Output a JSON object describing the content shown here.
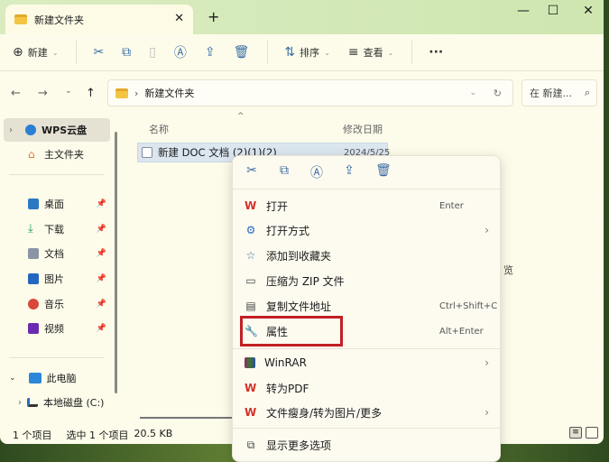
{
  "window": {
    "tab_title": "新建文件夹",
    "tab_close": "✕",
    "new_tab": "+",
    "minimize": "—",
    "maximize": "☐",
    "close": "✕"
  },
  "toolbar": {
    "new_label": "新建",
    "sort_label": "排序",
    "view_label": "查看",
    "more": "···"
  },
  "address": {
    "path": "新建文件夹",
    "search_placeholder": "在 新建..."
  },
  "sidebar": {
    "items": [
      {
        "label": "WPS云盘"
      },
      {
        "label": "主文件夹"
      },
      {
        "label": "桌面"
      },
      {
        "label": "下载"
      },
      {
        "label": "文档"
      },
      {
        "label": "图片"
      },
      {
        "label": "音乐"
      },
      {
        "label": "视频"
      },
      {
        "label": "此电脑"
      },
      {
        "label": "本地磁盘 (C:)"
      }
    ]
  },
  "content": {
    "col_name": "名称",
    "col_date": "修改日期",
    "file_name": "新建 DOC 文档 (2)(1)(2)",
    "file_date": "2024/5/25",
    "behind_text": "览"
  },
  "status": {
    "count": "1 个项目",
    "selected": "选中 1 个项目",
    "size": "20.5 KB"
  },
  "menu": {
    "items": [
      {
        "label": "打开",
        "shortcut": "Enter"
      },
      {
        "label": "打开方式",
        "submenu": true
      },
      {
        "label": "添加到收藏夹"
      },
      {
        "label": "压缩为 ZIP 文件"
      },
      {
        "label": "复制文件地址",
        "shortcut": "Ctrl+Shift+C"
      },
      {
        "label": "属性",
        "shortcut": "Alt+Enter",
        "highlighted": true
      },
      {
        "label": "WinRAR",
        "submenu": true
      },
      {
        "label": "转为PDF"
      },
      {
        "label": "文件瘦身/转为图片/更多",
        "submenu": true
      },
      {
        "label": "显示更多选项"
      }
    ]
  },
  "colors": {
    "highlight_box": "#c21f24",
    "wps_red": "#d4302a"
  }
}
